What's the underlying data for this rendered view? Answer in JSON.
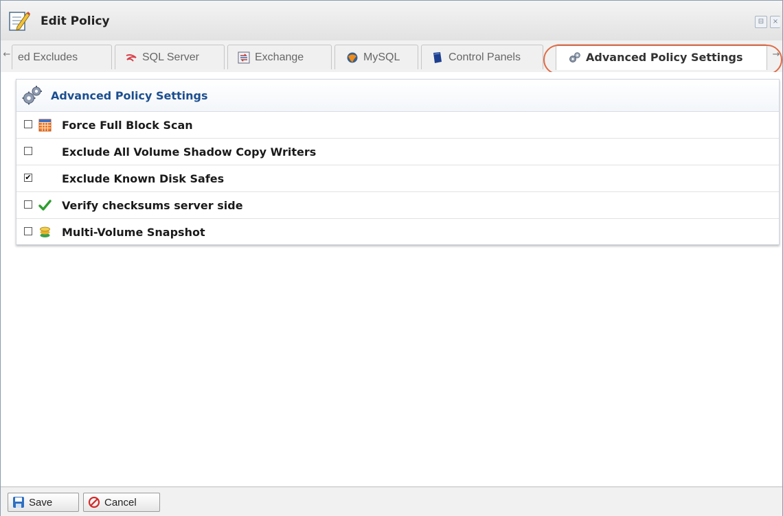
{
  "window": {
    "title": "Edit Policy",
    "min_glyph": "⊟",
    "close_glyph": "×",
    "icon": "edit-policy-icon"
  },
  "tabs": {
    "scroll_left_glyph": "←",
    "scroll_right_glyph": "→",
    "items": [
      {
        "label": "ed Excludes",
        "icon": ""
      },
      {
        "label": "SQL Server",
        "icon": "sql-server-icon"
      },
      {
        "label": "Exchange",
        "icon": "exchange-icon"
      },
      {
        "label": "MySQL",
        "icon": "mysql-icon"
      },
      {
        "label": "Control Panels",
        "icon": "control-panels-icon"
      },
      {
        "label": "Advanced Policy Settings",
        "icon": "gear-icon",
        "active": true
      }
    ],
    "highlight_color": "#e06a45"
  },
  "panel": {
    "title": "Advanced Policy Settings",
    "title_color": "#1c4f8f",
    "settings": [
      {
        "label": "Force Full Block Scan",
        "checked": false,
        "icon": "grid-icon"
      },
      {
        "label": "Exclude All Volume Shadow Copy Writers",
        "checked": false,
        "icon": ""
      },
      {
        "label": "Exclude Known Disk Safes",
        "checked": true,
        "icon": ""
      },
      {
        "label": "Verify checksums server side",
        "checked": false,
        "icon": "checkmark-icon"
      },
      {
        "label": "Multi-Volume Snapshot",
        "checked": false,
        "icon": "database-icon"
      }
    ]
  },
  "footer": {
    "save_label": "Save",
    "cancel_label": "Cancel"
  }
}
